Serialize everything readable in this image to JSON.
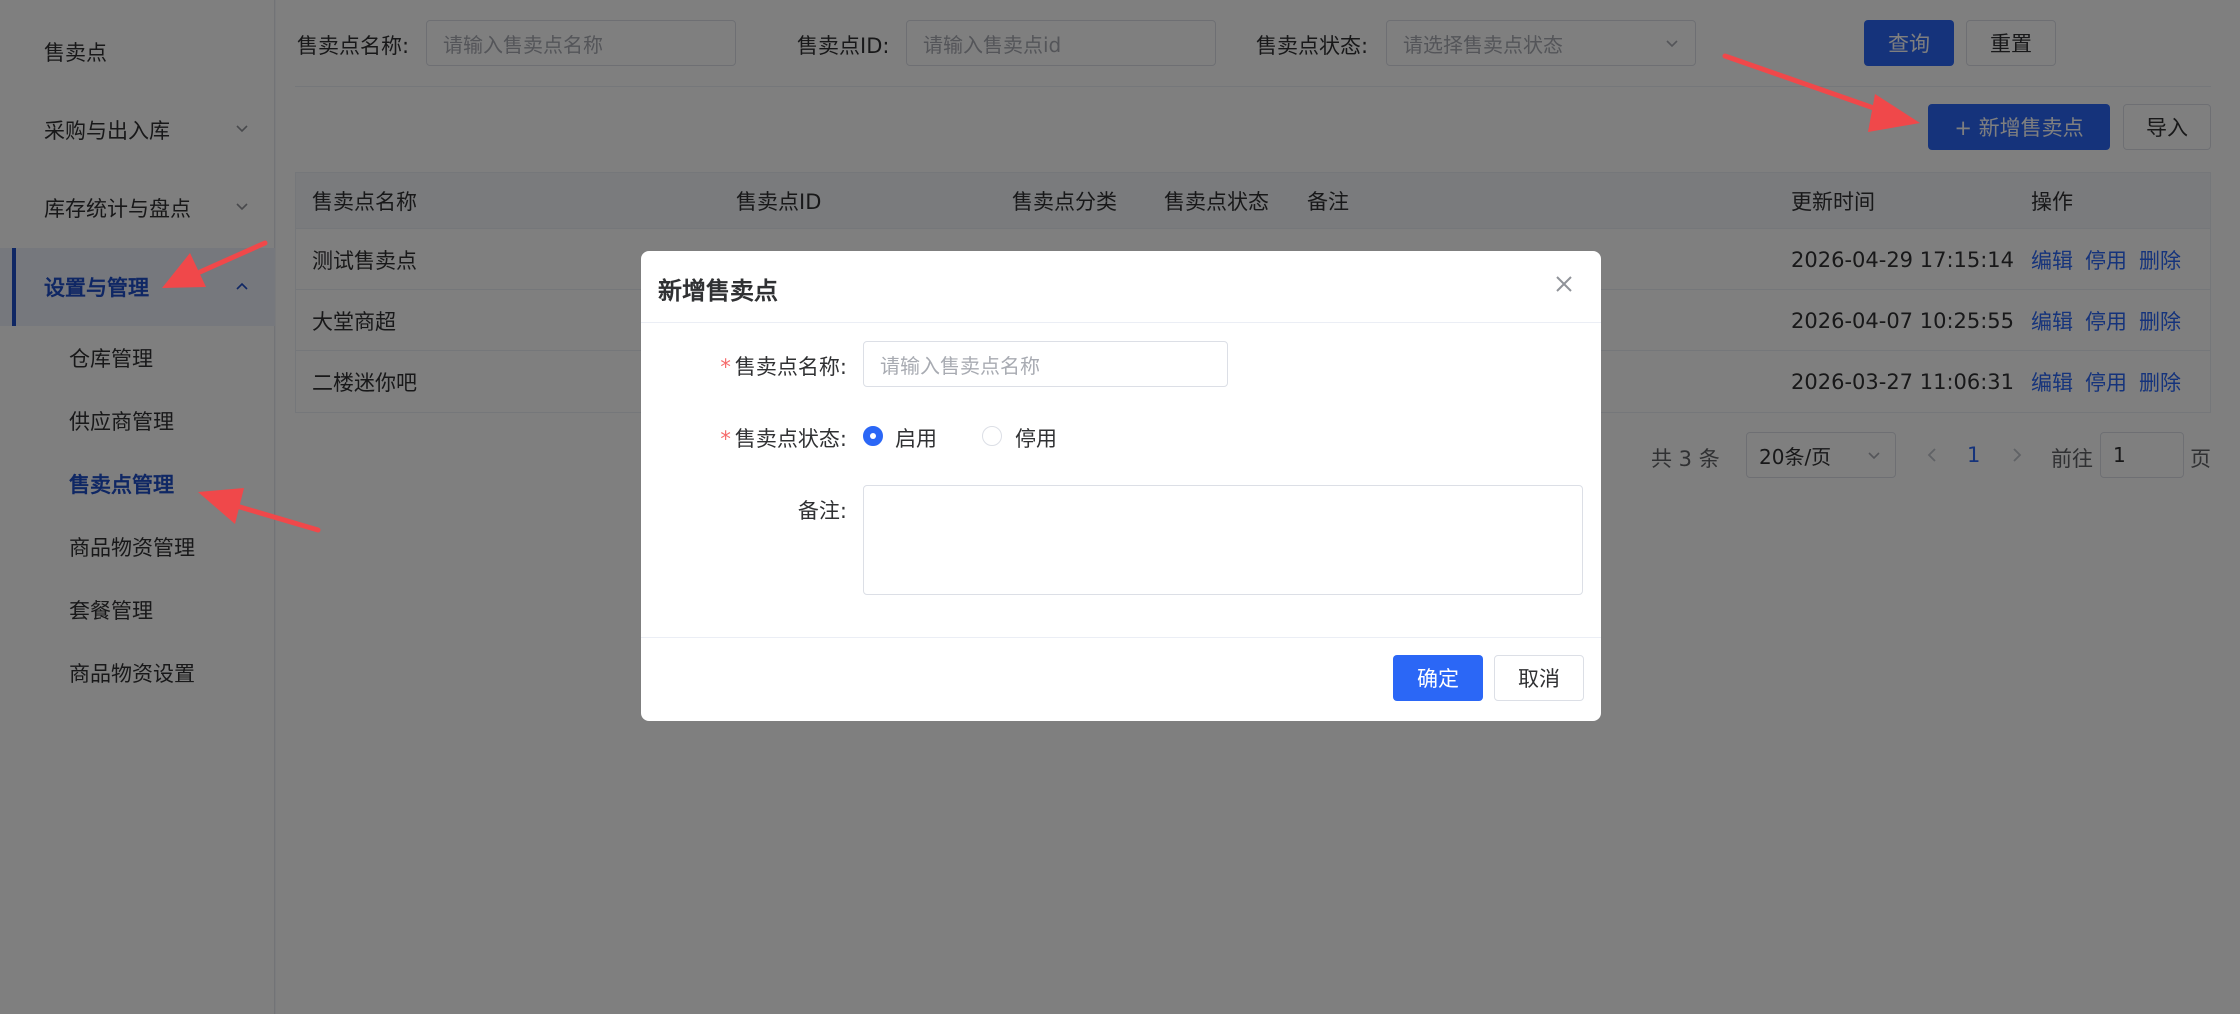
{
  "sidebar": {
    "items": [
      {
        "label": "售卖点"
      },
      {
        "label": "采购与出入库"
      },
      {
        "label": "库存统计与盘点"
      },
      {
        "label": "设置与管理"
      }
    ],
    "sub_items": [
      {
        "label": "仓库管理"
      },
      {
        "label": "供应商管理"
      },
      {
        "label": "售卖点管理"
      },
      {
        "label": "商品物资管理"
      },
      {
        "label": "套餐管理"
      },
      {
        "label": "商品物资设置"
      }
    ]
  },
  "filters": {
    "name_label": "售卖点名称:",
    "name_placeholder": "请输入售卖点名称",
    "id_label": "售卖点ID:",
    "id_placeholder": "请输入售卖点id",
    "status_label": "售卖点状态:",
    "status_placeholder": "请选择售卖点状态",
    "search_label": "查询",
    "reset_label": "重置"
  },
  "toolbar": {
    "add_label": "+ 新增售卖点",
    "import_label": "导入"
  },
  "table": {
    "columns": [
      "售卖点名称",
      "售卖点ID",
      "售卖点分类",
      "售卖点状态",
      "备注",
      "更新时间",
      "操作"
    ],
    "rows": [
      {
        "name": "测试售卖点",
        "updated": "2026-04-29 17:15:14"
      },
      {
        "name": "大堂商超",
        "updated": "2026-04-07 10:25:55"
      },
      {
        "name": "二楼迷你吧",
        "updated": "2026-03-27 11:06:31"
      }
    ],
    "actions": {
      "edit": "编辑",
      "disable": "停用",
      "delete": "删除"
    }
  },
  "pagination": {
    "total": "共 3 条",
    "page_size": "20条/页",
    "current_page": "1",
    "goto_label": "前往",
    "goto_value": "1",
    "page_suffix": "页"
  },
  "dialog": {
    "title": "新增售卖点",
    "name_label": "售卖点名称:",
    "name_placeholder": "请输入售卖点名称",
    "status_label": "售卖点状态:",
    "status_enabled": "启用",
    "status_disabled": "停用",
    "remark_label": "备注:",
    "confirm_label": "确定",
    "cancel_label": "取消"
  },
  "colors": {
    "primary": "#2b67f6",
    "active_menu": "#1f4ec8",
    "annotation_arrow": "#f0484a"
  }
}
